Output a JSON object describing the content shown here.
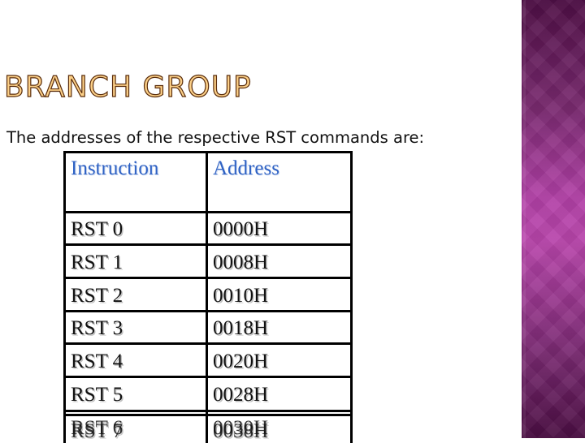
{
  "slide": {
    "title": "BRANCH GROUP",
    "subtitle": "The addresses of the respective RST commands are:",
    "colors": {
      "title_fill": "#fcd088",
      "title_outline": "#5a2d0c",
      "header_text": "#2f62c4",
      "panel_purple": "#b140a6"
    }
  },
  "table": {
    "headers": [
      "Instruction",
      "Address"
    ],
    "rows": [
      {
        "instruction": "RST 0",
        "address": "0000H"
      },
      {
        "instruction": "RST 1",
        "address": "0008H"
      },
      {
        "instruction": "RST 2",
        "address": "0010H"
      },
      {
        "instruction": "RST 3",
        "address": "0018H"
      },
      {
        "instruction": "RST 4",
        "address": "0020H"
      },
      {
        "instruction": "RST 5",
        "address": "0028H"
      },
      {
        "instruction": "RST 6",
        "address": "0030H"
      },
      {
        "instruction": "RST 7",
        "address": "0038H"
      }
    ]
  }
}
